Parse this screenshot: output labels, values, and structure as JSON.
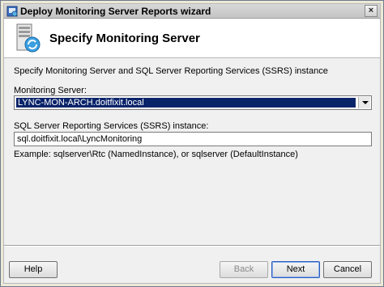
{
  "window": {
    "title": "Deploy Monitoring Server Reports wizard",
    "close_glyph": "×"
  },
  "header": {
    "title": "Specify Monitoring Server"
  },
  "form": {
    "intro": "Specify Monitoring Server and SQL Server Reporting Services (SSRS) instance",
    "monitoring_label": "Monitoring Server:",
    "monitoring_value": "LYNC-MON-ARCH.doitfixit.local",
    "ssrs_label": "SQL Server Reporting Services (SSRS) instance:",
    "ssrs_value": "sql.doitfixit.local\\LyncMonitoring",
    "example": "Example: sqlserver\\Rtc (NamedInstance), or sqlserver (DefaultInstance)"
  },
  "buttons": {
    "help": "Help",
    "back": "Back",
    "next": "Next",
    "cancel": "Cancel"
  },
  "colors": {
    "selection": "#0a246a",
    "default_button_border": "#2a5bbf"
  }
}
